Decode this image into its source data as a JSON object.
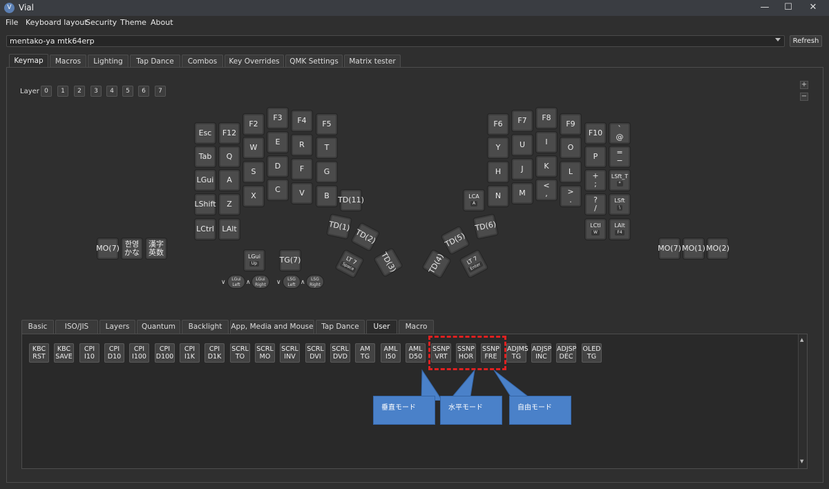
{
  "window": {
    "icon": "vial-app-icon",
    "title": "Vial",
    "controls": [
      "minimize-icon",
      "maximize-icon",
      "close-icon"
    ]
  },
  "menu": [
    "File",
    "Keyboard layout",
    "Security",
    "Theme",
    "About"
  ],
  "device_select": {
    "value": "mentako-ya mtk64erp"
  },
  "refresh_label": "Refresh",
  "tabs": [
    "Keymap",
    "Macros",
    "Lighting",
    "Tap Dance",
    "Combos",
    "Key Overrides",
    "QMK Settings",
    "Matrix tester"
  ],
  "active_tab": "Keymap",
  "layer": {
    "label": "Layer",
    "buttons": [
      "0",
      "1",
      "2",
      "3",
      "4",
      "5",
      "6",
      "7"
    ]
  },
  "zoom": {
    "in": "+",
    "out": "−"
  },
  "keys": {
    "l_esc": "Esc",
    "l_f12": "F12",
    "l_f2": "F2",
    "l_f3": "F3",
    "l_f4": "F4",
    "l_f5": "F5",
    "l_tab": "Tab",
    "l_q": "Q",
    "l_w": "W",
    "l_e": "E",
    "l_r": "R",
    "l_t": "T",
    "l_lgui": "LGui",
    "l_a": "A",
    "l_s": "S",
    "l_d": "D",
    "l_f": "F",
    "l_g": "G",
    "l_lshift": "LShift",
    "l_z": "Z",
    "l_x": "X",
    "l_c": "C",
    "l_v": "V",
    "l_b": "B",
    "l_lctrl": "LCtrl",
    "l_lalt": "LAlt",
    "l_td11": "TD(11)",
    "l_td1": "TD(1)",
    "l_td2": "TD(2)",
    "l_td3": "TD(3)",
    "l_lt7": "LT 7",
    "l_lt7_sub": "Space",
    "l_mo7": "MO(7)",
    "l_hanyeong_top": "한영",
    "l_hanyeong_bottom": "かな",
    "l_hanja_top": "漢字",
    "l_hanja_bottom": "英数",
    "l_lgui_up": "LGui",
    "l_lgui_up_sub": "Up",
    "l_tg7": "TG(7)",
    "r_f6": "F6",
    "r_f7": "F7",
    "r_f8": "F8",
    "r_f9": "F9",
    "r_f10": "F10",
    "r_grave_top": "`",
    "r_grave_bottom": "@",
    "r_y": "Y",
    "r_u": "U",
    "r_i": "I",
    "r_o": "O",
    "r_p": "P",
    "r_eq_top": "=",
    "r_eq_bottom": "−",
    "r_h": "H",
    "r_j": "J",
    "r_k": "K",
    "r_l": "L",
    "r_plus_top": "+",
    "r_plus_bottom": ";",
    "r_lsft_t": "LSft_T",
    "r_lsft_t_sub": "*",
    "r_lca": "LCA",
    "r_lca_sub": "A",
    "r_n": "N",
    "r_m": "M",
    "r_lt_top": "<",
    "r_lt_bottom": ",",
    "r_gt_top": ">",
    "r_gt_bottom": ".",
    "r_q_top": "?",
    "r_q_bottom": "/",
    "r_lsft": "LSft",
    "r_lsft_sub": "\\",
    "r_lctl": "LCtl",
    "r_lctl_sub": "W",
    "r_lalt": "LAlt",
    "r_lalt_sub": "F4",
    "r_td4": "TD(4)",
    "r_td5": "TD(5)",
    "r_td6": "TD(6)",
    "r_lt7": "LT 7",
    "r_lt7_sub": "Enter",
    "r_mo7": "MO(7)",
    "r_mo1": "MO(1)",
    "r_mo2": "MO(2)"
  },
  "encoders": [
    {
      "top": "LGui",
      "bottom": "Left"
    },
    {
      "top": "LGui",
      "bottom": "Right"
    },
    {
      "top": "LSG",
      "bottom": "Left"
    },
    {
      "top": "LSG",
      "bottom": "Right"
    }
  ],
  "bottom_tabs": [
    "Basic",
    "ISO/JIS",
    "Layers",
    "Quantum",
    "Backlight",
    "App, Media and Mouse",
    "Tap Dance",
    "User",
    "Macro"
  ],
  "active_bottom_tab": "User",
  "user_keys": [
    {
      "l1": "KBC",
      "l2": "RST"
    },
    {
      "l1": "KBC",
      "l2": "SAVE"
    },
    {
      "l1": "CPI",
      "l2": "I10"
    },
    {
      "l1": "CPI",
      "l2": "D10"
    },
    {
      "l1": "CPI",
      "l2": "I100"
    },
    {
      "l1": "CPI",
      "l2": "D100"
    },
    {
      "l1": "CPI",
      "l2": "I1K"
    },
    {
      "l1": "CPI",
      "l2": "D1K"
    },
    {
      "l1": "SCRL",
      "l2": "TO"
    },
    {
      "l1": "SCRL",
      "l2": "MO"
    },
    {
      "l1": "SCRL",
      "l2": "INV"
    },
    {
      "l1": "SCRL",
      "l2": "DVI"
    },
    {
      "l1": "SCRL",
      "l2": "DVD"
    },
    {
      "l1": "AM",
      "l2": "TG"
    },
    {
      "l1": "AML",
      "l2": "I50"
    },
    {
      "l1": "AML",
      "l2": "D50"
    },
    {
      "l1": "SSNP",
      "l2": "VRT"
    },
    {
      "l1": "SSNP",
      "l2": "HOR"
    },
    {
      "l1": "SSNP",
      "l2": "FRE"
    },
    {
      "l1": "ADJMS",
      "l2": "TG"
    },
    {
      "l1": "ADJSP",
      "l2": "INC"
    },
    {
      "l1": "ADJSP",
      "l2": "DEC"
    },
    {
      "l1": "OLED",
      "l2": "TG"
    }
  ],
  "callouts": [
    "垂直モード",
    "水平モード",
    "自由モード"
  ],
  "colors": {
    "highlight": "#e02020",
    "callout": "#4a81c9"
  }
}
